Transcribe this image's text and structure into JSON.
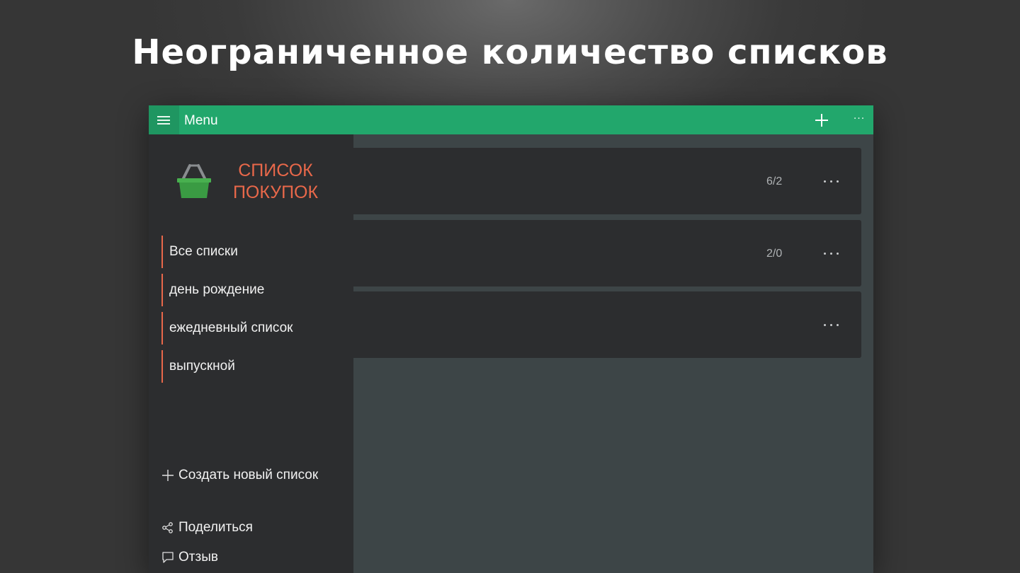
{
  "headline": "Неограниченное количество списков",
  "app": {
    "topbar": {
      "menu_label": "Menu",
      "add_icon": "plus-icon",
      "more_icon": "more-icon",
      "more_label": "···",
      "color": "#22a76c"
    },
    "sidebar": {
      "logo_icon": "basket-icon",
      "logo_line1": "СПИСОК",
      "logo_line2": "ПОКУПОК",
      "accent": "#e8684a",
      "lists": [
        {
          "label": "Все списки"
        },
        {
          "label": "день рождение"
        },
        {
          "label": "ежедневный список"
        },
        {
          "label": "выпускной"
        }
      ],
      "create_label": "Создать новый список",
      "share_label": "Поделиться",
      "feedback_label": "Отзыв"
    },
    "cards": [
      {
        "count": "6/2"
      },
      {
        "count": "2/0"
      },
      {
        "count": ""
      }
    ]
  }
}
